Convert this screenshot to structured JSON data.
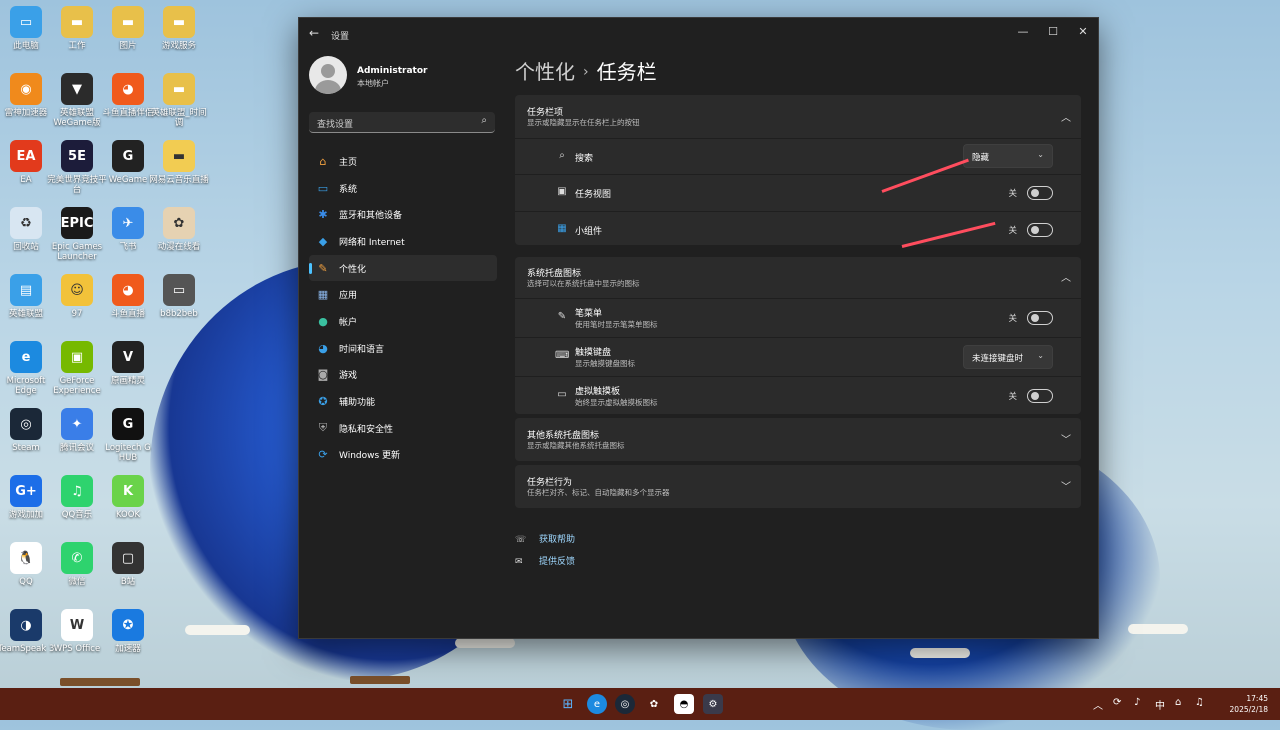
{
  "desktop": {
    "icons": [
      {
        "label": "此电脑",
        "color": "#3aa0e8",
        "glyph": "▭"
      },
      {
        "label": "工作",
        "color": "#e8c04a",
        "glyph": "▬"
      },
      {
        "label": "图片",
        "color": "#e8c04a",
        "glyph": "▬"
      },
      {
        "label": "游戏服务",
        "color": "#e8c04a",
        "glyph": "▬"
      },
      {
        "label": "雷神加速器",
        "color": "#f08a1c",
        "glyph": "◉"
      },
      {
        "label": "英雄联盟WeGame版",
        "color": "#2b2b2b",
        "glyph": "▼"
      },
      {
        "label": "斗鱼直播伴侣",
        "color": "#f05a1c",
        "glyph": "◕"
      },
      {
        "label": "英雄联盟_时间调",
        "color": "#e8c04a",
        "glyph": "▬"
      },
      {
        "label": "EA",
        "color": "#e23a1c",
        "glyph": "EA"
      },
      {
        "label": "完美世界竞技平台",
        "color": "#1c1c3a",
        "glyph": "5E"
      },
      {
        "label": "WeGame",
        "color": "#222",
        "glyph": "G"
      },
      {
        "label": "网易云音乐直播",
        "color": "#f2cc52",
        "glyph": "▬"
      },
      {
        "label": "回收站",
        "color": "#d8e6f2",
        "glyph": "♻"
      },
      {
        "label": "Epic Games Launcher",
        "color": "#1a1a1a",
        "glyph": "EPIC"
      },
      {
        "label": "飞书",
        "color": "#3a8ce8",
        "glyph": "✈"
      },
      {
        "label": "动漫在线看",
        "color": "#e6d2b2",
        "glyph": "✿"
      },
      {
        "label": "英雄联盟",
        "color": "#3aa0e8",
        "glyph": "▤"
      },
      {
        "label": "97",
        "color": "#f2c23a",
        "glyph": "☺"
      },
      {
        "label": "斗鱼直播",
        "color": "#f05a1c",
        "glyph": "◕"
      },
      {
        "label": "b8b2beb",
        "color": "#555",
        "glyph": "▭"
      },
      {
        "label": "Microsoft Edge",
        "color": "#1c8ae0",
        "glyph": "e"
      },
      {
        "label": "GeForce Experience",
        "color": "#76b900",
        "glyph": "▣"
      },
      {
        "label": "原画精灵",
        "color": "#222",
        "glyph": "V"
      },
      {
        "label": "",
        "color": "transparent",
        "glyph": ""
      },
      {
        "label": "Steam",
        "color": "#1b2838",
        "glyph": "◎"
      },
      {
        "label": "腾讯会议",
        "color": "#3a7ee8",
        "glyph": "✦"
      },
      {
        "label": "Logitech G HUB",
        "color": "#111",
        "glyph": "G"
      },
      {
        "label": "",
        "color": "transparent",
        "glyph": ""
      },
      {
        "label": "游戏加加",
        "color": "#1c6ee8",
        "glyph": "G+"
      },
      {
        "label": "QQ音乐",
        "color": "#2ed36e",
        "glyph": "♫"
      },
      {
        "label": "KOOK",
        "color": "#6ad34a",
        "glyph": "K"
      },
      {
        "label": "",
        "color": "transparent",
        "glyph": ""
      },
      {
        "label": "QQ",
        "color": "#ffffff",
        "glyph": "🐧"
      },
      {
        "label": "微信",
        "color": "#2ed36e",
        "glyph": "✆"
      },
      {
        "label": "B站",
        "color": "#333",
        "glyph": "▢"
      },
      {
        "label": "",
        "color": "transparent",
        "glyph": ""
      },
      {
        "label": "TeamSpeak 3",
        "color": "#1a3a6a",
        "glyph": "◑"
      },
      {
        "label": "WPS Office",
        "color": "#fff",
        "glyph": "W"
      },
      {
        "label": "加速器",
        "color": "#1a7ae0",
        "glyph": "✪"
      },
      {
        "label": "",
        "color": "transparent",
        "glyph": ""
      }
    ]
  },
  "window": {
    "title": "设置",
    "min_icon": "minimize-icon",
    "max_icon": "maximize-icon",
    "close_icon": "close-icon",
    "user": {
      "name": "Administrator",
      "type": "本地帐户"
    },
    "search_placeholder": "查找设置",
    "nav": [
      {
        "label": "主页",
        "icon": "⌂",
        "color": "#f0a040"
      },
      {
        "label": "系统",
        "icon": "▭",
        "color": "#3aa0e8"
      },
      {
        "label": "蓝牙和其他设备",
        "icon": "✱",
        "color": "#3a8ce8"
      },
      {
        "label": "网络和 Internet",
        "icon": "◆",
        "color": "#3aa0e8"
      },
      {
        "label": "个性化",
        "icon": "✎",
        "color": "#f0a040",
        "active": true
      },
      {
        "label": "应用",
        "icon": "▦",
        "color": "#8ab4e8"
      },
      {
        "label": "帐户",
        "icon": "●",
        "color": "#3ac0a0"
      },
      {
        "label": "时间和语言",
        "icon": "◕",
        "color": "#3aa0e8"
      },
      {
        "label": "游戏",
        "icon": "◙",
        "color": "#aaa"
      },
      {
        "label": "辅助功能",
        "icon": "✪",
        "color": "#3aa0e8"
      },
      {
        "label": "隐私和安全性",
        "icon": "⛨",
        "color": "#aaa"
      },
      {
        "label": "Windows 更新",
        "icon": "⟳",
        "color": "#3aa0e8"
      }
    ],
    "breadcrumb": {
      "parent": "个性化",
      "separator": "›",
      "current": "任务栏"
    },
    "sections": {
      "taskbar_items": {
        "title": "任务栏项",
        "subtitle": "显示或隐藏显示在任务栏上的按钮",
        "search": {
          "label": "搜索",
          "value": "隐藏"
        },
        "task_view": {
          "label": "任务视图",
          "state": "关"
        },
        "widgets": {
          "label": "小组件",
          "state": "关"
        }
      },
      "tray_icons": {
        "title": "系统托盘图标",
        "subtitle": "选择可以在系统托盘中显示的图标",
        "pen_menu": {
          "label": "笔菜单",
          "sub": "使用笔时显示笔菜单图标",
          "state": "关"
        },
        "touch_keyboard": {
          "label": "触摸键盘",
          "sub": "显示触摸键盘图标",
          "value": "未连接键盘时"
        },
        "touchpad": {
          "label": "虚拟触摸板",
          "sub": "始终显示虚拟触摸板图标",
          "state": "关"
        }
      },
      "other_tray": {
        "title": "其他系统托盘图标",
        "subtitle": "显示或隐藏其他系统托盘图标"
      },
      "behaviors": {
        "title": "任务栏行为",
        "subtitle": "任务栏对齐、标记、自动隐藏和多个显示器"
      }
    },
    "links": {
      "help": "获取帮助",
      "feedback": "提供反馈"
    }
  },
  "taskbar": {
    "tray": {
      "lang": "中"
    },
    "clock": {
      "time": "17:45",
      "date": "2025/2/18"
    }
  },
  "colors": {
    "accent": "#4cc2ff",
    "annotation_arrow": "#ff4d5e",
    "taskbar_bg": "#5a1f12"
  }
}
